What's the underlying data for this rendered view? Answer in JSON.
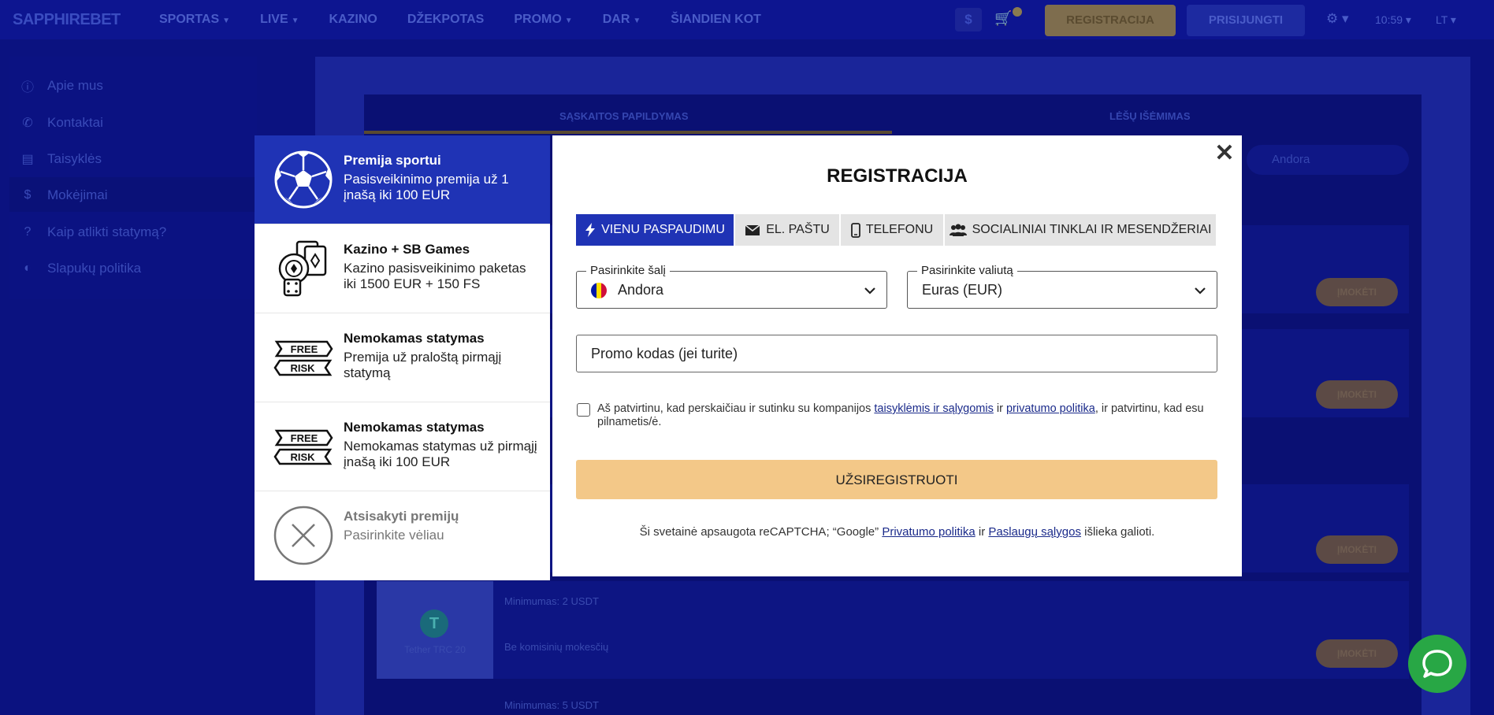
{
  "header": {
    "logo": "SAPPHIREBET",
    "nav": [
      {
        "label": "SPORTAS",
        "chevron": true
      },
      {
        "label": "LIVE",
        "chevron": true
      },
      {
        "label": "KAZINO",
        "chevron": false
      },
      {
        "label": "DŽEKPOTAS",
        "chevron": false
      },
      {
        "label": "PROMO",
        "chevron": true
      },
      {
        "label": "DAR",
        "chevron": true
      },
      {
        "label": "ŠIANDIEN KOT",
        "chevron": false
      }
    ],
    "currency_symbol": "$",
    "register_label": "REGISTRACIJA",
    "login_label": "PRISIJUNGTI",
    "time": "10:59",
    "language": "LT"
  },
  "sidebar": {
    "items": [
      {
        "label": "Apie mus",
        "icon": "info-icon"
      },
      {
        "label": "Kontaktai",
        "icon": "phone-icon"
      },
      {
        "label": "Taisyklės",
        "icon": "document-icon"
      },
      {
        "label": "Mokėjimai",
        "icon": "dollar-icon",
        "active": true
      },
      {
        "label": "Kaip atlikti statymą?",
        "icon": "question-icon"
      },
      {
        "label": "Slapukų politika",
        "icon": "cookie-icon"
      }
    ]
  },
  "background": {
    "tab_deposit": "SĄSKAITOS PAPILDYMAS",
    "tab_withdraw": "LĖŠŲ IŠĖMIMAS",
    "country_select": "Andora",
    "pay_label": "ĮMOKĖTI",
    "tether_label": "Tether TRC 20",
    "min_label_1": "Minimumas: 2 USDT",
    "no_fee_label": "Be komisinių mokesčių",
    "min_label_2": "Minimumas: 5 USDT"
  },
  "bonuses": [
    {
      "title": "Premija sportui",
      "desc": "Pasisveikinimo premija už 1 įnašą iki 100 EUR",
      "icon": "soccer-ball-icon",
      "selected": true
    },
    {
      "title": "Kazino + SB Games",
      "desc": "Kazino pasisveikinimo paketas iki 1500 EUR + 150 FS",
      "icon": "casino-cards-chip-dice-icon",
      "selected": false
    },
    {
      "title": "Nemokamas statymas",
      "desc": "Premija už praloštą pirmąjį statymą",
      "icon": "free-risk-icon",
      "selected": false
    },
    {
      "title": "Nemokamas statymas",
      "desc": "Nemokamas statymas už pirmąjį įnašą iki 100 EUR",
      "icon": "free-risk-icon",
      "selected": false
    },
    {
      "title": "Atsisakyti premijų",
      "desc": "Pasirinkite vėliau",
      "icon": "decline-x-icon",
      "selected": false
    }
  ],
  "free_risk": {
    "free": "FREE",
    "risk": "RISK"
  },
  "modal": {
    "title": "REGISTRACIJA",
    "close": "✕",
    "tabs": [
      {
        "label": "VIENU PASPAUDIMU",
        "icon": "lightning-icon",
        "active": true
      },
      {
        "label": "EL. PAŠTU",
        "icon": "envelope-icon",
        "active": false
      },
      {
        "label": "TELEFONU",
        "icon": "phone-icon",
        "active": false
      },
      {
        "label": "SOCIALINIAI TINKLAI IR MESENDŽERIAI",
        "icon": "users-icon",
        "active": false
      }
    ],
    "country": {
      "label": "Pasirinkite šalį",
      "value": "Andora",
      "flag_colors": [
        "#0018A8",
        "#FEDF00",
        "#D0103A"
      ]
    },
    "currency": {
      "label": "Pasirinkite valiutą",
      "value": "Euras (EUR)"
    },
    "promo_placeholder": "Promo kodas (jei turite)",
    "terms": {
      "part1": "Aš patvirtinu, kad perskaičiau ir sutinku su kompanijos ",
      "link1": "taisyklėmis ir sąlygomis",
      "part2": " ir ",
      "link2": "privatumo politika",
      "part3": ", ir patvirtinu, kad esu pilnametis/ė."
    },
    "submit_label": "UŽSIREGISTRUOTI",
    "recaptcha": {
      "part1": "Ši svetainė apsaugota reCAPTCHA; “Google” ",
      "link1": "Privatumo politika",
      "part2": " ir ",
      "link2": "Paslaugų sąlygos",
      "part3": " išlieka galioti."
    }
  },
  "colors": {
    "brand_blue": "#1f33b5",
    "overlay_navy": "#0b1280",
    "submit_peach": "#f3c888",
    "chat_green": "#28a745"
  }
}
